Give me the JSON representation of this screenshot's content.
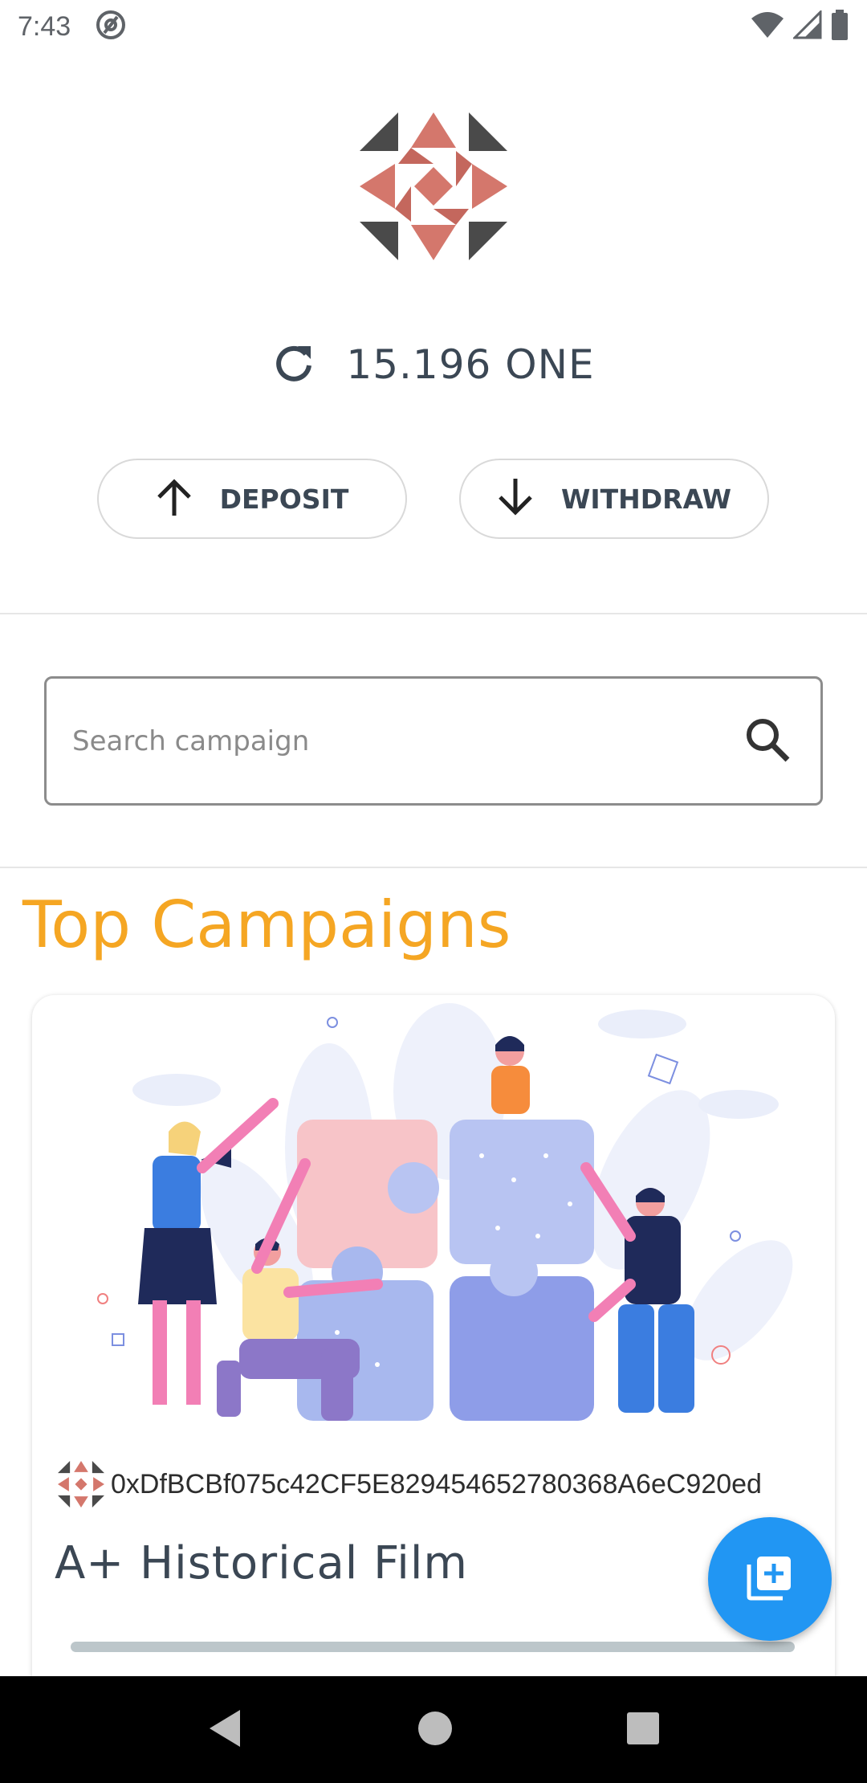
{
  "status_bar": {
    "time": "7:43",
    "icons": [
      "at-sign-icon",
      "wifi-icon",
      "signal-icon",
      "battery-icon"
    ]
  },
  "wallet": {
    "balance": "15.196 ONE",
    "refresh_icon": "refresh-icon",
    "deposit_label": "DEPOSIT",
    "withdraw_label": "WITHDRAW"
  },
  "search": {
    "placeholder": "Search campaign",
    "value": ""
  },
  "section": {
    "title": "Top Campaigns"
  },
  "campaigns": [
    {
      "owner_address": "0xDfBCBf075c42CF5E829454652780368A6eC920ed",
      "title": "A+ Historical Film",
      "progress": 0.0
    }
  ],
  "fab": {
    "icon": "add-to-library-icon"
  },
  "colors": {
    "accent": "#2196f3",
    "section_title": "#f5a623",
    "text_dark": "#3b4754",
    "logo_dark": "#4a4a4a",
    "logo_accent": "#d4776c"
  }
}
